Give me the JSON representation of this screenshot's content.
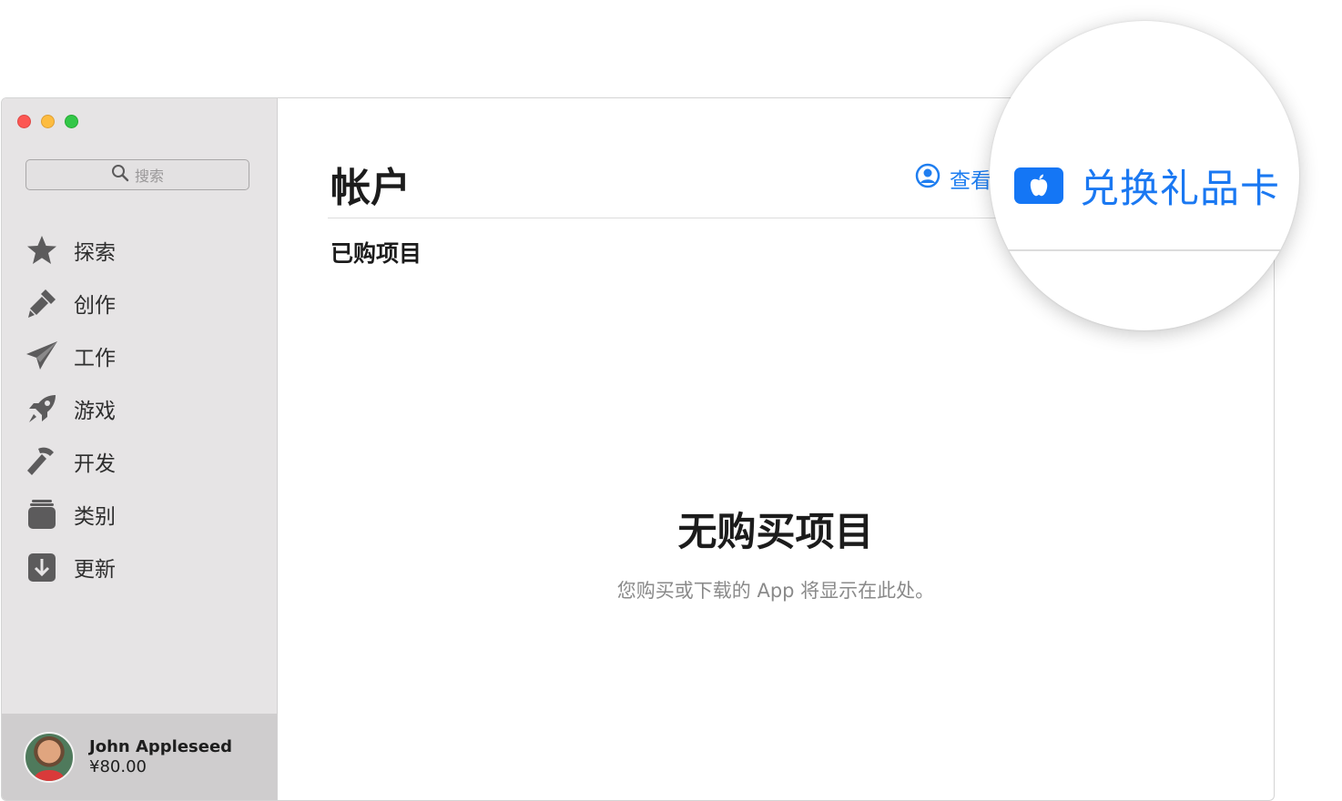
{
  "sidebar": {
    "search_placeholder": "搜索",
    "items": [
      {
        "label": "探索",
        "icon": "star-icon"
      },
      {
        "label": "创作",
        "icon": "brush-icon"
      },
      {
        "label": "工作",
        "icon": "paper-plane-icon"
      },
      {
        "label": "游戏",
        "icon": "rocket-icon"
      },
      {
        "label": "开发",
        "icon": "hammer-icon"
      },
      {
        "label": "类别",
        "icon": "stack-icon"
      },
      {
        "label": "更新",
        "icon": "download-icon"
      }
    ],
    "account": {
      "name": "John Appleseed",
      "balance": "¥80.00"
    }
  },
  "main": {
    "title": "帐户",
    "view_info_label": "查看",
    "section_title": "已购项目",
    "empty_title": "无购买项目",
    "empty_subtitle": "您购买或下载的 App 将显示在此处。"
  },
  "callout": {
    "redeem_label": "兑换礼品卡"
  },
  "colors": {
    "accent": "#1a78f2",
    "sidebar_bg": "#e6e4e5",
    "account_bg": "#cfcdce"
  }
}
